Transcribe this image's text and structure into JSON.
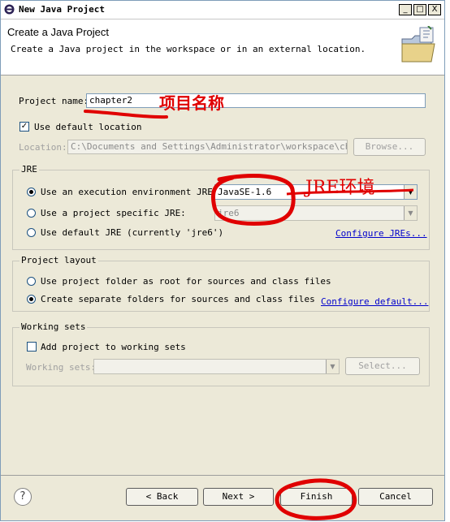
{
  "window": {
    "title": "New Java Project",
    "buttons": [
      "_",
      "□",
      "X"
    ]
  },
  "banner": {
    "heading": "Create a Java Project",
    "description": "Create a Java project in the workspace or in an external location."
  },
  "project": {
    "name_label": "Project name:",
    "name_value": "chapter2",
    "use_default_label": "Use default location",
    "location_label": "Location:",
    "location_value": "C:\\Documents and Settings\\Administrator\\workspace\\chapter",
    "browse_label": "Browse..."
  },
  "jre": {
    "group_title": "JRE",
    "exec_env_label": "Use an execution environment JRE:",
    "exec_env_value": "JavaSE-1.6",
    "specific_label": "Use a project specific JRE:",
    "specific_value": "jre6",
    "default_label": "Use default JRE (currently 'jre6')",
    "configure_link": "Configure JREs..."
  },
  "layout": {
    "group_title": "Project layout",
    "root_label": "Use project folder as root for sources and class files",
    "separate_label": "Create separate folders for sources and class files",
    "configure_link": "Configure default..."
  },
  "working_sets": {
    "group_title": "Working sets",
    "add_label": "Add project to working sets",
    "sets_label": "Working sets:",
    "select_label": "Select..."
  },
  "footer": {
    "help": "?",
    "back": "< Back",
    "next": "Next >",
    "finish": "Finish",
    "cancel": "Cancel"
  },
  "annotations": {
    "project_name": "项目名称",
    "jre": "JRE环境"
  },
  "colors": {
    "annotation": "#e00000",
    "link": "#0000cc",
    "dialog_bg": "#ece9d8"
  }
}
